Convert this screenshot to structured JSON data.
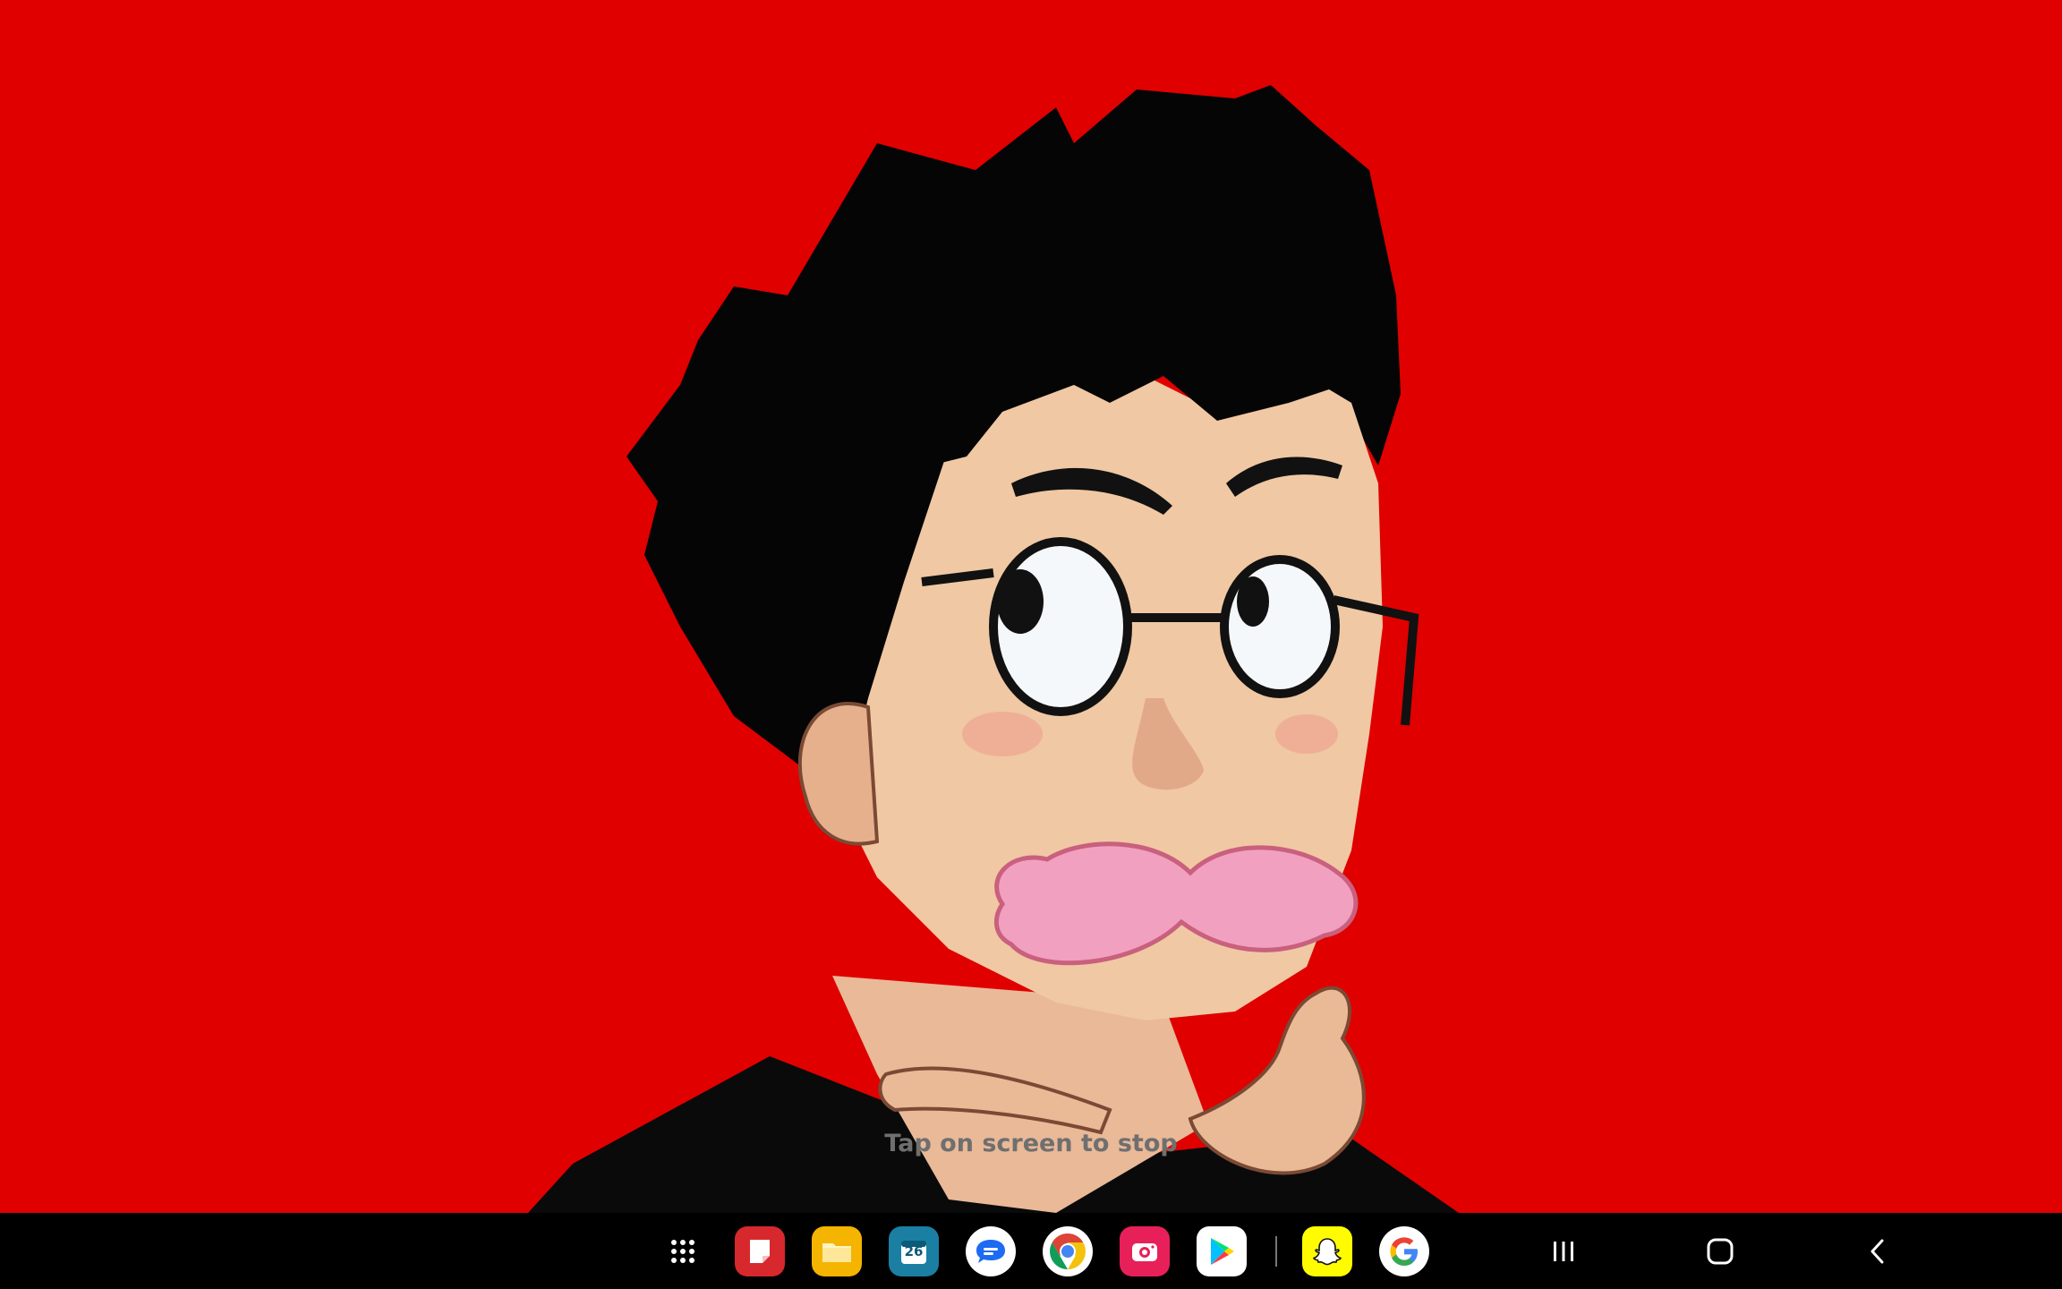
{
  "hint": {
    "text": "Tap on screen to stop"
  },
  "colors": {
    "background": "#e00000",
    "taskbar": "#000000",
    "hint_text": "#6f6f6f",
    "hair": "#050505",
    "skin": "#f0c8a3",
    "mustache": "#f2a0c0"
  },
  "taskbar": {
    "apps": [
      {
        "name": "apps-grid-icon"
      },
      {
        "name": "notes-icon",
        "color": "#d7282e"
      },
      {
        "name": "files-icon",
        "color": "#f4b400"
      },
      {
        "name": "calendar-icon",
        "color": "#1a7fa3",
        "label": "26"
      },
      {
        "name": "messages-icon",
        "color": "#ffffff"
      },
      {
        "name": "chrome-icon",
        "color": "#ffffff"
      },
      {
        "name": "camera-icon",
        "color": "#e8205a"
      },
      {
        "name": "play-store-icon",
        "color": "#ffffff"
      },
      {
        "name": "snapchat-icon",
        "color": "#fffc00"
      },
      {
        "name": "google-icon",
        "color": "#ffffff"
      }
    ],
    "nav": [
      "recents-icon",
      "home-icon",
      "back-icon"
    ]
  }
}
